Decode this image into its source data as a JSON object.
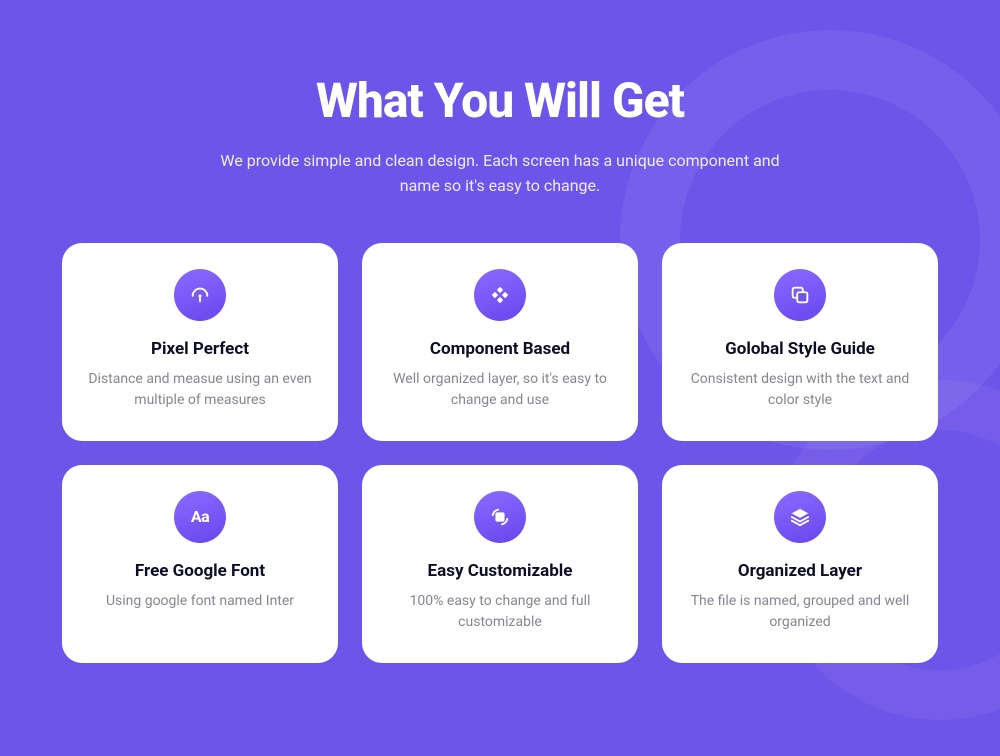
{
  "heading": "What You Will Get",
  "subheading": "We provide simple and clean design. Each screen has a unique component and name so it's easy to change.",
  "features": [
    {
      "icon": "pixel-perfect-icon",
      "title": "Pixel Perfect",
      "desc": "Distance and measue using an even multiple of measures"
    },
    {
      "icon": "component-based-icon",
      "title": "Component Based",
      "desc": "Well organized layer, so it's easy to change and use"
    },
    {
      "icon": "global-style-icon",
      "title": "Golobal Style Guide",
      "desc": "Consistent design with the text and color style"
    },
    {
      "icon": "font-icon",
      "title": "Free Google Font",
      "desc": "Using google font named Inter"
    },
    {
      "icon": "customizable-icon",
      "title": "Easy Customizable",
      "desc": "100% easy to change and full customizable"
    },
    {
      "icon": "layers-icon",
      "title": "Organized Layer",
      "desc": "The file is named, grouped and well organized"
    }
  ]
}
